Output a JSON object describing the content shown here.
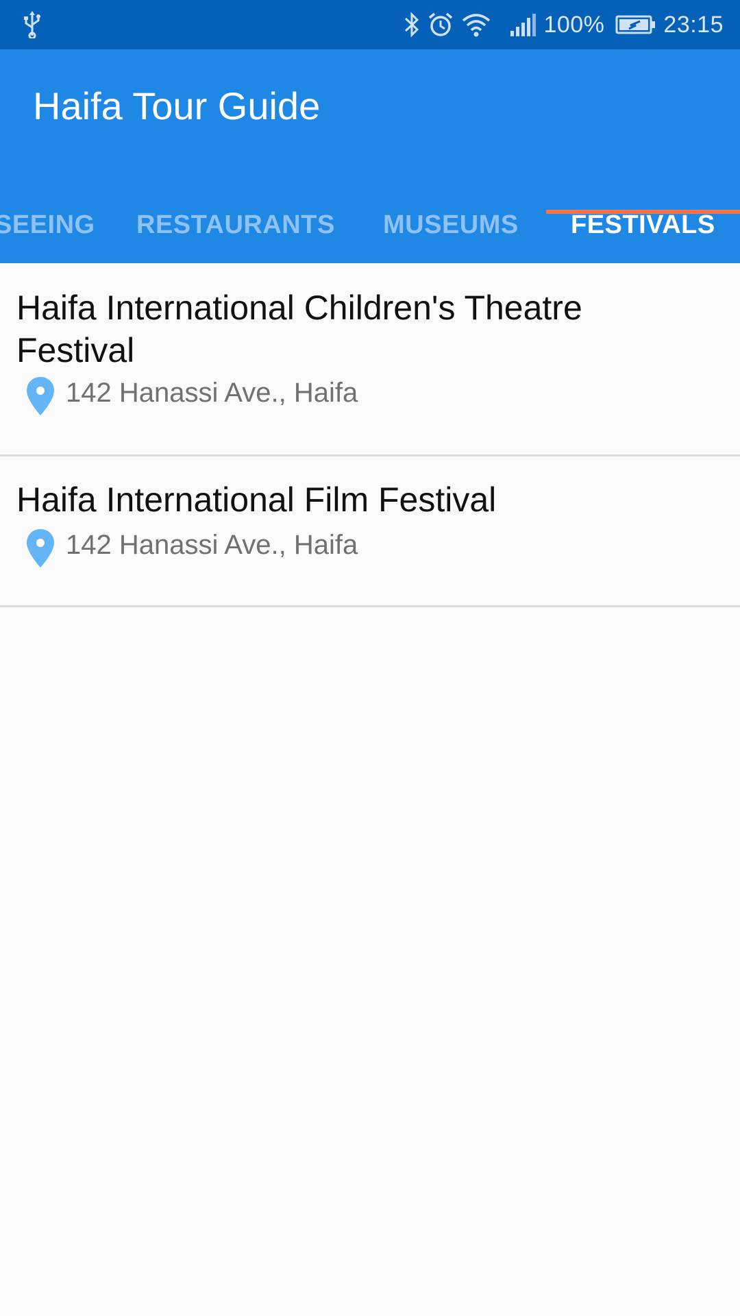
{
  "status_bar": {
    "battery_percent": "100%",
    "time": "23:15",
    "icons": [
      "usb-icon",
      "bluetooth-icon",
      "alarm-icon",
      "wifi-icon",
      "signal-icon",
      "battery-icon"
    ]
  },
  "app": {
    "title": "Haifa Tour Guide"
  },
  "tabs": [
    {
      "label": "SIGHTSEEING",
      "visible_text": "SEEING"
    },
    {
      "label": "RESTAURANTS",
      "visible_text": "RESTAURANTS"
    },
    {
      "label": "MUSEUMS",
      "visible_text": "MUSEUMS"
    },
    {
      "label": "FESTIVALS",
      "visible_text": "FESTIVALS",
      "active": true
    }
  ],
  "festivals": [
    {
      "title": "Haifa International Children's Theatre Festival",
      "address": "142 Hanassi Ave., Haifa"
    },
    {
      "title": "Haifa International Film Festival",
      "address": "142 Hanassi Ave., Haifa"
    }
  ],
  "colors": {
    "status_bar": "#0561b7",
    "app_bar": "#1f88e5",
    "tab_indicator": "#ff7043",
    "pin": "#64b5f6"
  }
}
